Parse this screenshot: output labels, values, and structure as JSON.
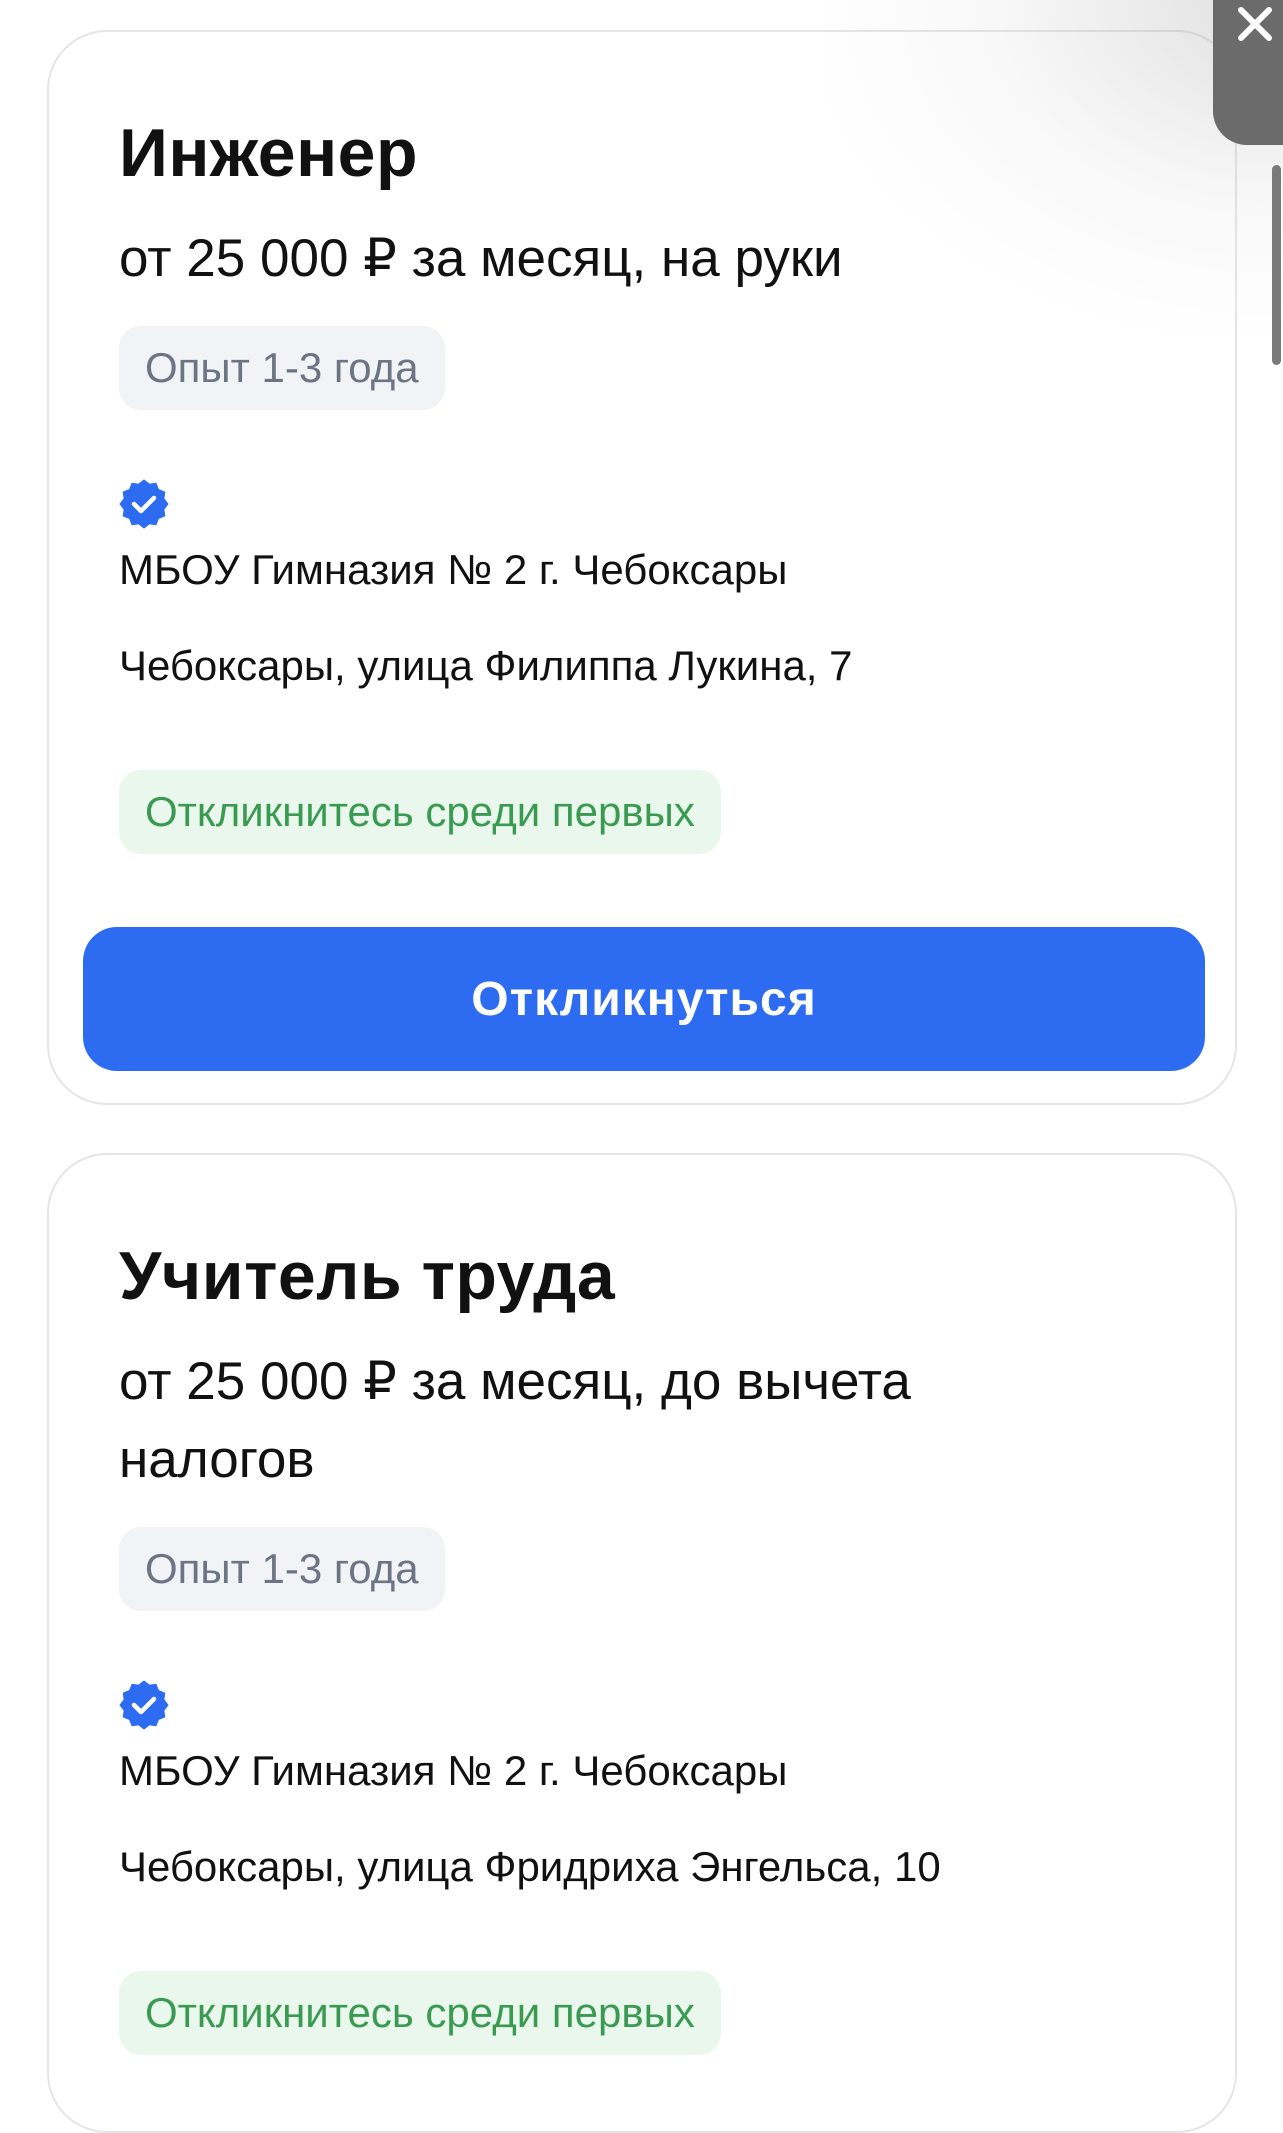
{
  "vacancies": [
    {
      "title": "Инженер",
      "salary": "от 25 000 ₽ за месяц, на руки",
      "experience": "Опыт 1-3 года",
      "company": "МБОУ Гимназия № 2 г. Чебоксары",
      "address": "Чебоксары, улица Филиппа Лукина, 7",
      "badge": "Откликнитесь среди первых",
      "button": "Откликнуться"
    },
    {
      "title": "Учитель труда",
      "salary": "от 25 000 ₽ за месяц, до вычета налогов",
      "experience": "Опыт 1-3 года",
      "company": "МБОУ Гимназия № 2 г. Чебоксары",
      "address": "Чебоксары, улица Фридриха Энгельса, 10",
      "badge": "Откликнитесь среди первых"
    }
  ],
  "icons": {
    "verified": "verified-check-icon",
    "close": "close-icon"
  },
  "colors": {
    "accent": "#2d6cf0",
    "badge_green_text": "#3a9a52",
    "badge_green_bg": "#eaf7ec",
    "chip_gray_bg": "#f1f3f6",
    "chip_gray_text": "#6d7584"
  }
}
